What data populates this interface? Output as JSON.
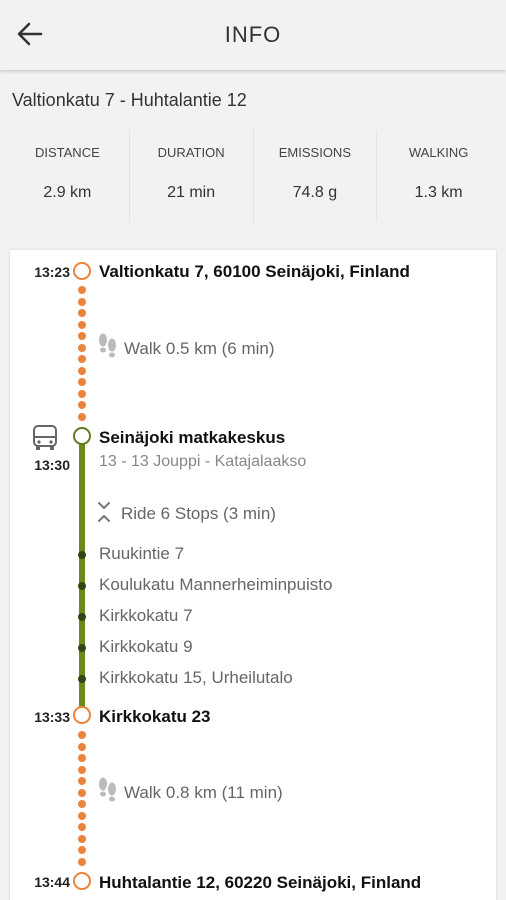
{
  "header": {
    "title": "INFO"
  },
  "route": {
    "title": "Valtionkatu 7 - Huhtalantie 12"
  },
  "stats": [
    {
      "label": "DISTANCE",
      "value": "2.9 km"
    },
    {
      "label": "DURATION",
      "value": "21 min"
    },
    {
      "label": "EMISSIONS",
      "value": "74.8 g"
    },
    {
      "label": "WALKING",
      "value": "1.3 km"
    }
  ],
  "itinerary": {
    "start": {
      "time": "13:23",
      "name": "Valtionkatu 7, 60100 Seinäjoki, Finland"
    },
    "walk1": {
      "text": "Walk 0.5 km (6 min)"
    },
    "board": {
      "time": "13:30",
      "name": "Seinäjoki matkakeskus",
      "line": "13 - 13 Jouppi - Katajalaakso"
    },
    "ride": {
      "text": "Ride 6 Stops (3 min)"
    },
    "intermediate": [
      "Ruukintie 7",
      "Koulukatu Mannerheiminpuisto",
      "Kirkkokatu 7",
      "Kirkkokatu 9",
      "Kirkkokatu 15, Urheilutalo"
    ],
    "alight": {
      "time": "13:33",
      "name": "Kirkkokatu 23"
    },
    "walk2": {
      "text": "Walk 0.8 km (11 min)"
    },
    "end": {
      "time": "13:44",
      "name": "Huhtalantie 12, 60220 Seinäjoki, Finland"
    }
  },
  "colors": {
    "walk": "#e8843c",
    "bus": "#6a8a1e",
    "bus_stop": "#2f4615"
  },
  "icons": {
    "back": "arrow-left-icon",
    "walk": "footsteps-icon",
    "bus": "bus-icon",
    "ride": "expand-icon"
  }
}
